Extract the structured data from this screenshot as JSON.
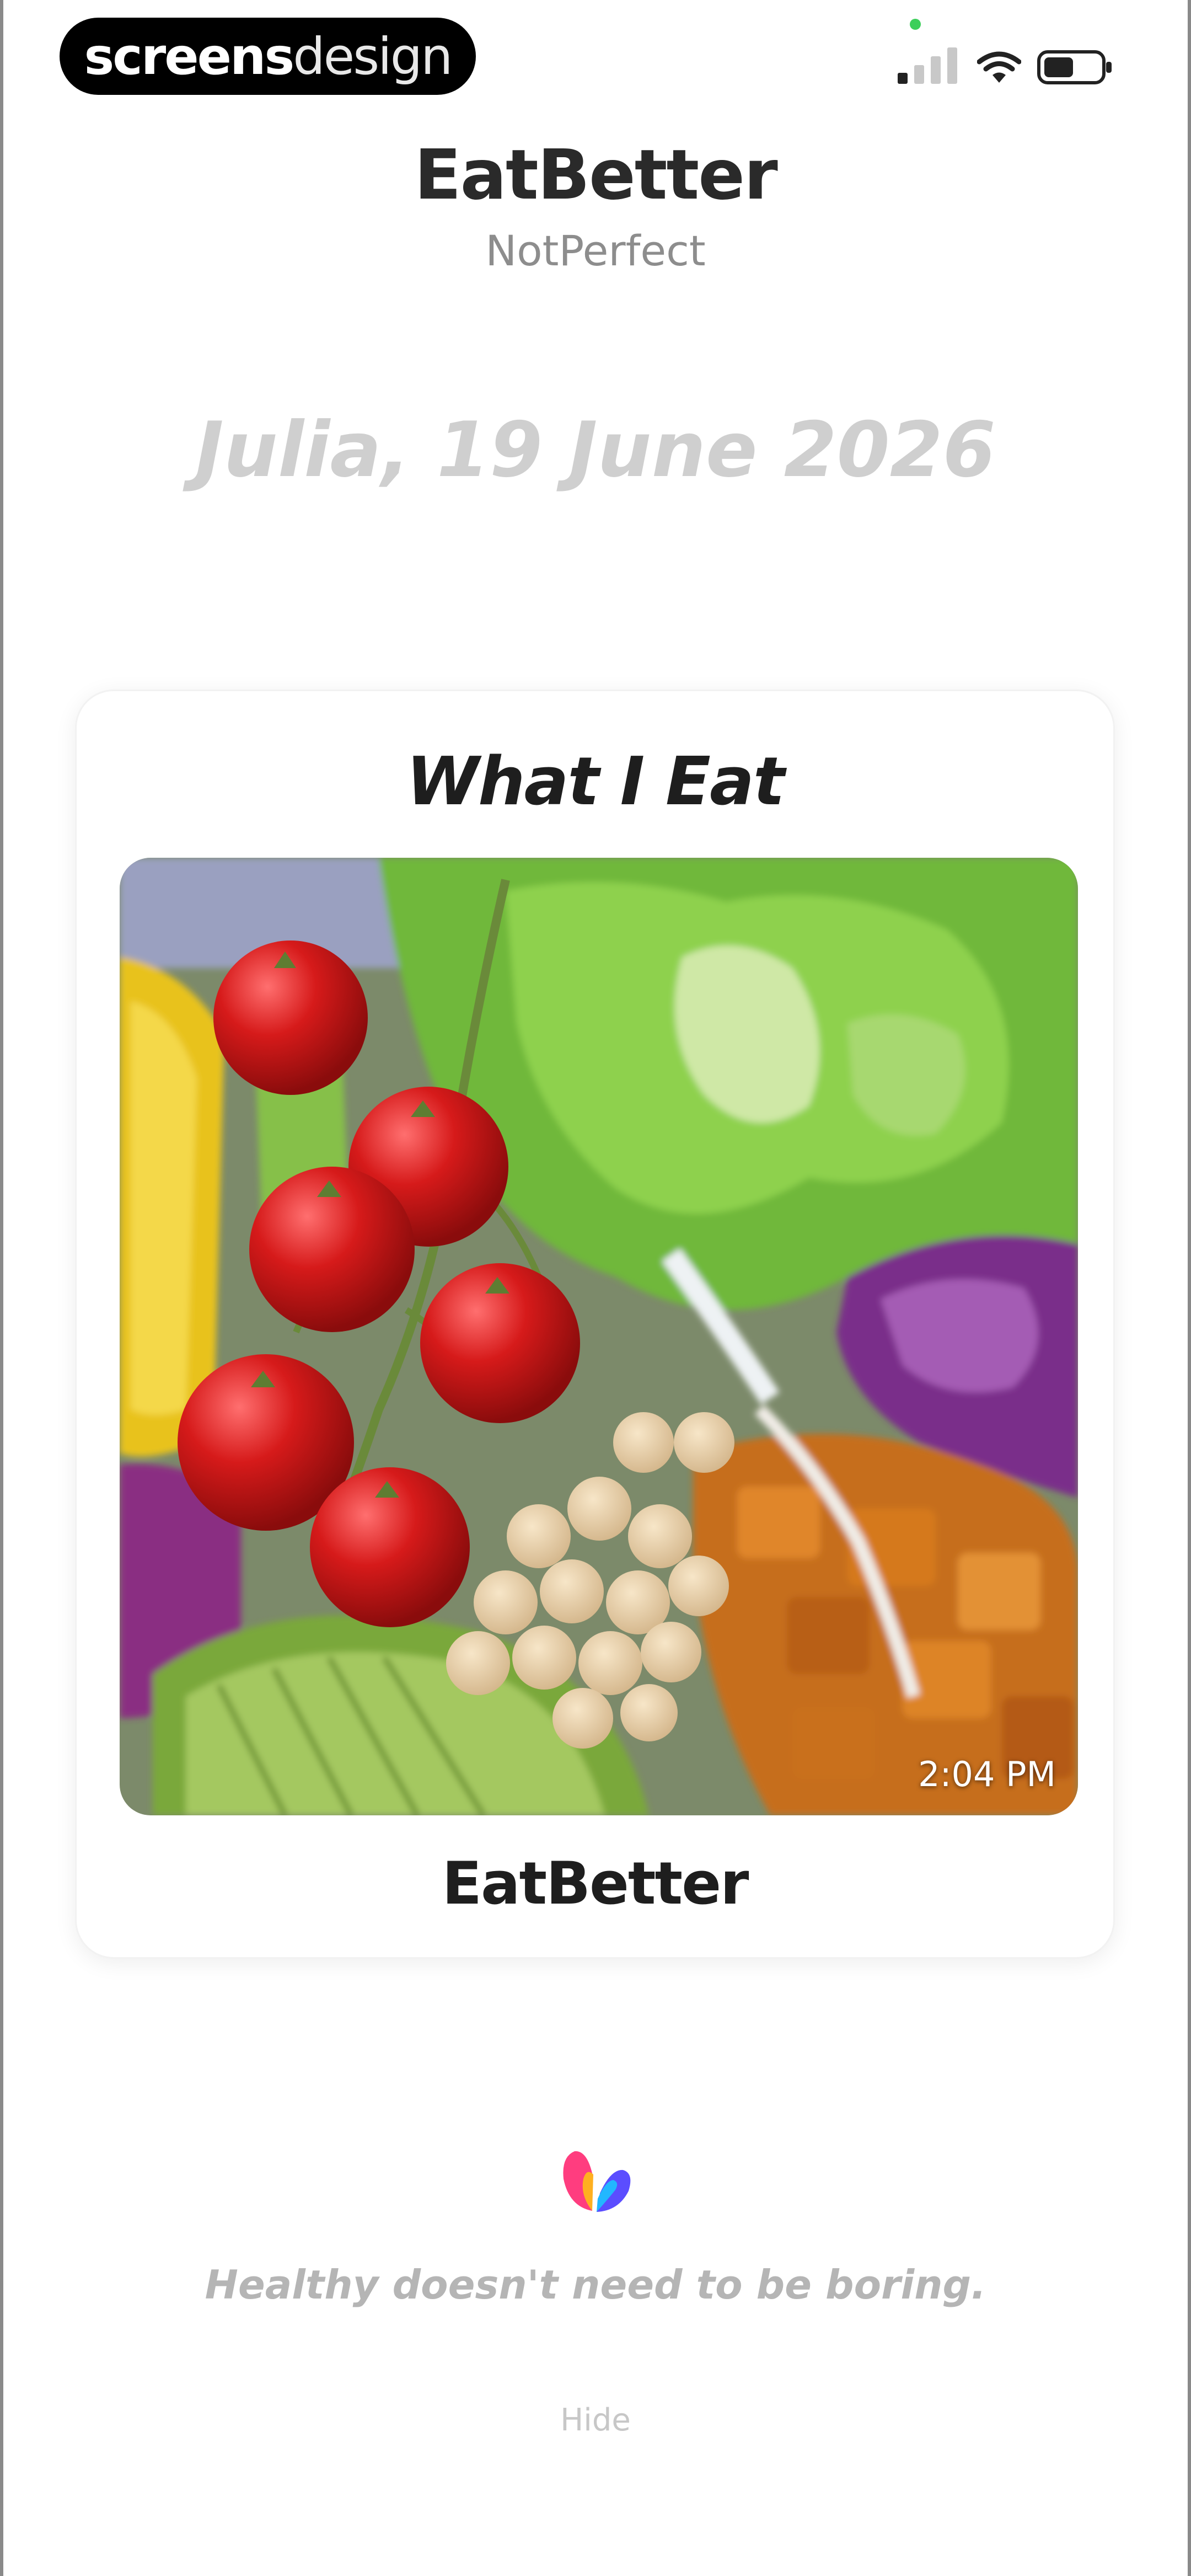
{
  "status_bar": {
    "brand_bold": "screens",
    "brand_light": "design",
    "signal_icon": "signal-icon",
    "wifi_icon": "wifi-icon",
    "battery_icon": "battery-icon",
    "dot_color": "#3ccf5a"
  },
  "header": {
    "title": "EatBetter",
    "subtitle": "NotPerfect",
    "date_line": "Julia, 19 June 2026"
  },
  "card": {
    "title": "What I Eat",
    "photo_timestamp": "2:04 PM",
    "footer": "EatBetter"
  },
  "footer": {
    "logo_icon": "butterfly-logo-icon",
    "tagline": "Healthy doesn't need to be boring.",
    "hide_label": "Hide"
  }
}
